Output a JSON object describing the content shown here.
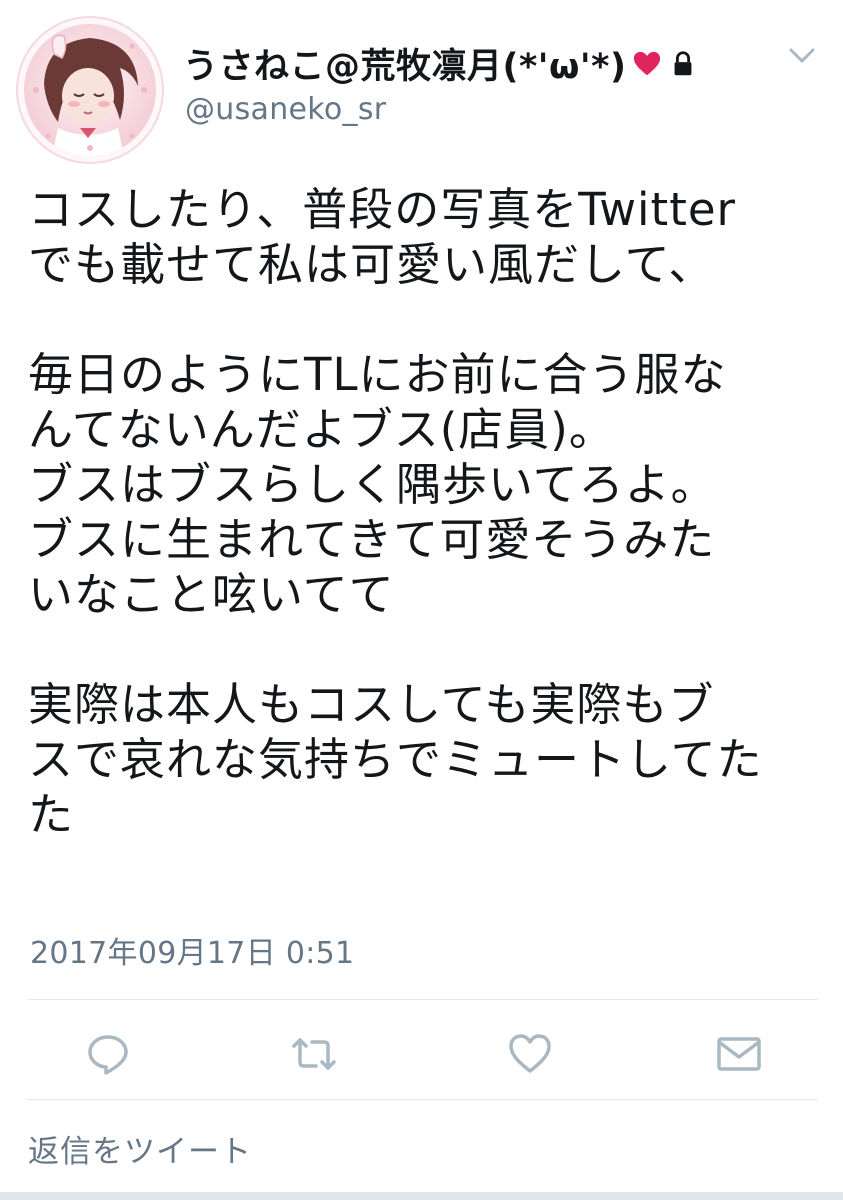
{
  "user": {
    "display_name": "うさねこ@荒牧凛月(*'ω'*)",
    "handle": "@usaneko_sr",
    "heart_icon": "heart-icon",
    "lock_icon": "lock-icon"
  },
  "tweet": {
    "lines": [
      "コスしたり、普段の写真をTwitter",
      "でも載せて私は可愛い風だして、",
      "",
      "毎日のようにTLにお前に合う服な",
      "んてないんだよブス(店員)。",
      "ブスはブスらしく隅歩いてろよ。",
      "ブスに生まれてきて可愛そうみた",
      "いなこと呟いてて",
      "",
      "実際は本人もコスしても実際もブ",
      "スで哀れな気持ちでミュートしてた",
      "た"
    ],
    "timestamp": "2017年09月17日 0:51"
  },
  "actions": {
    "reply_icon": "reply-icon",
    "retweet_icon": "retweet-icon",
    "like_icon": "heart-outline-icon",
    "dm_icon": "envelope-icon"
  },
  "reply_prompt": "返信をツイート",
  "colors": {
    "text": "#14171a",
    "secondary": "#657786",
    "heart": "#e0245e",
    "icon": "#aab8c2",
    "divider": "#e1e8ed"
  }
}
